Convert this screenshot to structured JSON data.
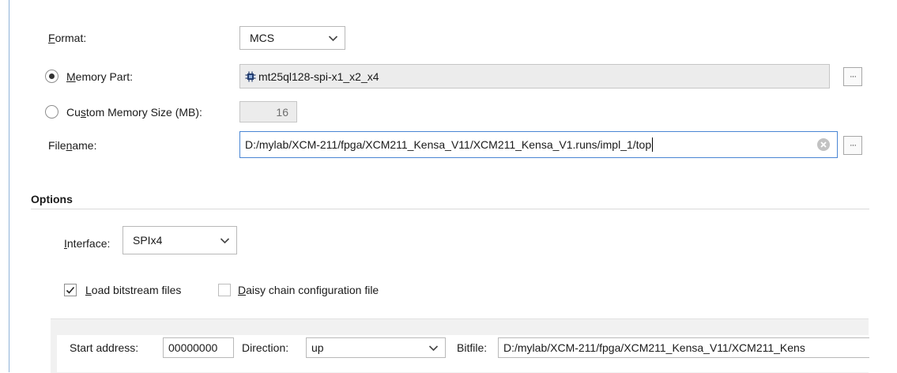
{
  "format": {
    "label_hot": "F",
    "label_rest": "ormat:",
    "value": "MCS"
  },
  "memory_part": {
    "label_hot": "M",
    "label_rest": "emory Part:",
    "value": "mt25ql128-spi-x1_x2_x4",
    "selected": true,
    "browse_label": "···"
  },
  "custom_memory": {
    "label_pre": "Cu",
    "label_hot": "s",
    "label_rest": "tom Memory Size (MB):",
    "value": "16",
    "selected": false
  },
  "filename": {
    "label_pre": "File",
    "label_hot": "n",
    "label_rest": "ame:",
    "value": "D:/mylab/XCM-211/fpga/XCM211_Kensa_V11/XCM211_Kensa_V1.runs/impl_1/top",
    "browse_label": "···"
  },
  "options": {
    "header": "Options",
    "interface": {
      "label_hot": "I",
      "label_rest": "nterface:",
      "value": "SPIx4"
    },
    "load_bitstream": {
      "label_hot": "L",
      "label_rest": "oad bitstream files",
      "checked": true
    },
    "daisy_chain": {
      "label_hot": "D",
      "label_rest": "aisy chain configuration file",
      "checked": false
    }
  },
  "bitstream_row": {
    "start_address_label": "Start address:",
    "start_address_value": "00000000",
    "direction_label": "Direction:",
    "direction_value": "up",
    "bitfile_label": "Bitfile:",
    "bitfile_value": "D:/mylab/XCM-211/fpga/XCM211_Kensa_V11/XCM211_Kens"
  },
  "colors": {
    "focus_border": "#4a86d4",
    "readonly_bg": "#ececec",
    "accent_rule": "#8fb3d9"
  }
}
